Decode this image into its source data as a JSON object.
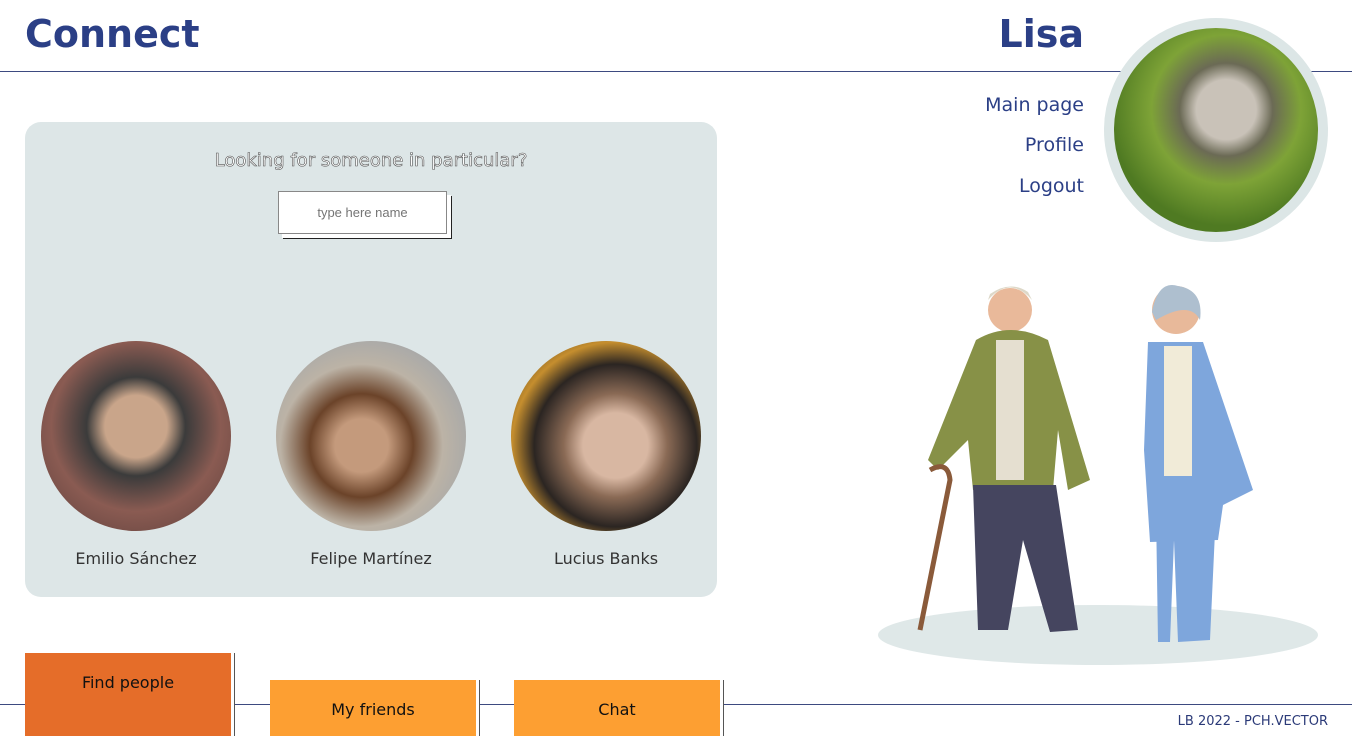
{
  "header": {
    "brand": "Connect",
    "user_name": "Lisa"
  },
  "nav": [
    {
      "label": "Main page"
    },
    {
      "label": "Profile"
    },
    {
      "label": "Logout"
    }
  ],
  "search": {
    "question": "Looking for someone in particular?",
    "placeholder": "type here name"
  },
  "people": [
    {
      "name": "Emilio Sánchez"
    },
    {
      "name": "Felipe Martínez"
    },
    {
      "name": "Lucius Banks"
    }
  ],
  "tabs": [
    {
      "label": "Find people",
      "active": true
    },
    {
      "label": "My friends"
    },
    {
      "label": "Chat"
    }
  ],
  "footer": {
    "text": "LB 2022 - PCH.VECTOR"
  },
  "colors": {
    "brand": "#2b3f86",
    "active_tab": "#e56d29",
    "tab": "#fd9f32",
    "panel": "#dde6e7"
  }
}
